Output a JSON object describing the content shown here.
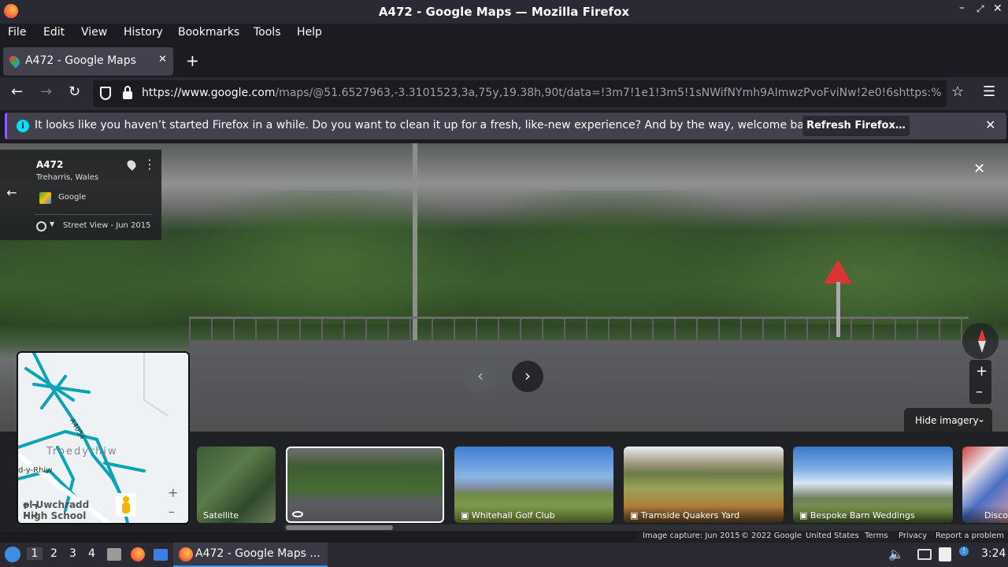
{
  "window": {
    "title": "A472 - Google Maps — Mozilla Firefox"
  },
  "menu": [
    "File",
    "Edit",
    "View",
    "History",
    "Bookmarks",
    "Tools",
    "Help"
  ],
  "tab": {
    "label": "A472 - Google Maps"
  },
  "url": {
    "host": "https://www.google.com",
    "path": "/maps/@51.6527963,-3.3101523,3a,75y,19.38h,90t/data=!3m7!1e1!3m5!1sNWifNYmh9AImwzPvoFviNw!2e0!6shttps:%"
  },
  "notification": {
    "text": "It looks like you haven’t started Firefox in a while. Do you want to clean it up for a fresh, like-new experience? And by the way, welcome back!",
    "button": "Refresh Firefox…"
  },
  "panel": {
    "title": "A472",
    "subtitle": "Treharris, Wales",
    "source": "Google",
    "street_view": "Street View - Jun 2015"
  },
  "minimap": {
    "road": "A4054",
    "town": "Troedyrhiw",
    "left_label": "d-y-Rhiw",
    "school": "ol Uwchradd\nHigh School"
  },
  "imagery": {
    "hide": "Hide imagery",
    "items": [
      {
        "label": "Satellite"
      },
      {
        "label": ""
      },
      {
        "label": "Whitehall Golf Club"
      },
      {
        "label": "Tramside Quakers Yard"
      },
      {
        "label": "Bespoke Barn Weddings"
      },
      {
        "label": "Disco"
      }
    ]
  },
  "footer": {
    "capture": "Image capture: Jun 2015",
    "copyright": "© 2022 Google",
    "country": "United States",
    "terms": "Terms",
    "privacy": "Privacy",
    "report": "Report a problem"
  },
  "taskbar": {
    "workspaces": [
      "1",
      "2",
      "3",
      "4"
    ],
    "app": "A472 - Google Maps ...",
    "clock": "3:24"
  },
  "colors": {
    "chrome_dark": "#1c1b22",
    "chrome": "#2b2a33",
    "accent": "#9059ff",
    "info": "#00ddff"
  }
}
